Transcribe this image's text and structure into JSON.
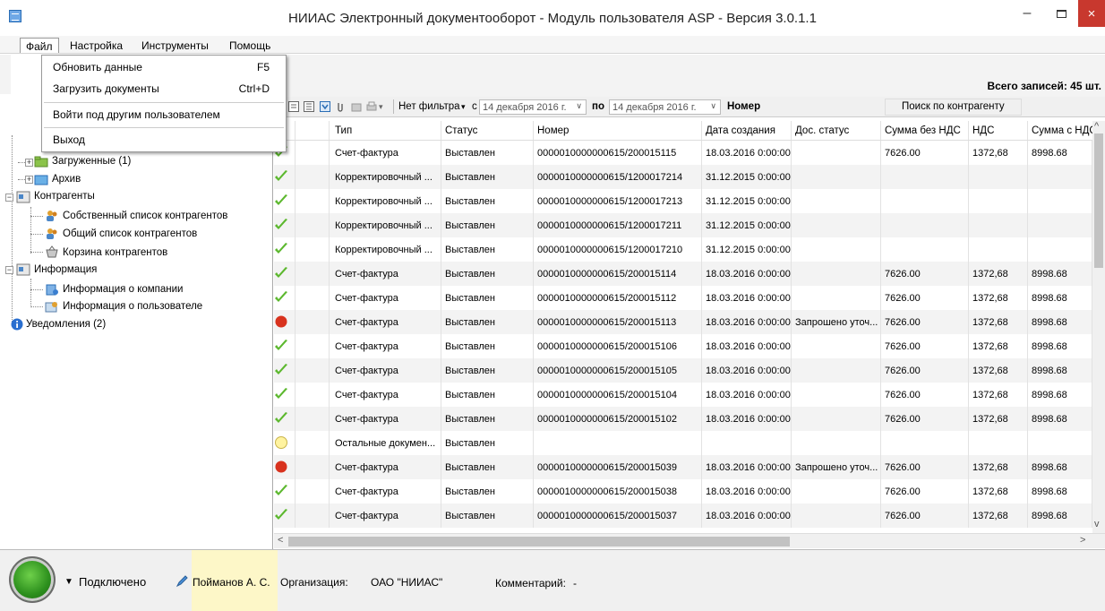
{
  "window": {
    "title": "НИИАС Электронный документооборот - Модуль пользователя ASP - Версия 3.0.1.1",
    "minimize": "–",
    "close": "×"
  },
  "menu": {
    "items": [
      "Файл",
      "Настройка",
      "Инструменты",
      "Помощь"
    ],
    "file_dropdown": {
      "refresh": "Обновить данные",
      "refresh_shortcut": "F5",
      "load": "Загрузить документы",
      "load_shortcut": "Ctrl+D",
      "switch_user": "Войти под другим пользователем",
      "exit": "Выход"
    }
  },
  "tree": {
    "loaded": "Загруженные (1)",
    "archive": "Архив",
    "counterparties": "Контрагенты",
    "own_list": "Собственный список контрагентов",
    "common_list": "Общий список контрагентов",
    "basket": "Корзина контрагентов",
    "info": "Информация",
    "company_info": "Информация о компании",
    "user_info": "Информация о пользователе",
    "notifications": "Уведомления (2)"
  },
  "summary": {
    "total": "Всего записей: 45 шт."
  },
  "filter": {
    "no_filter": "Нет фильтра",
    "from_label": "с",
    "from_date": "14 декабря  2016 г.",
    "to_label": "по",
    "to_date": "14 декабря  2016 г.",
    "number_label": "Номер",
    "search_counterparty": "Поиск по контрагенту"
  },
  "grid": {
    "columns": [
      "Тип",
      "Статус",
      "Номер",
      "Дата создания",
      "Дос. статус",
      "Сумма без НДС",
      "НДС",
      "Сумма с НДС"
    ],
    "rows": [
      {
        "status_icon": "check",
        "type": "Счет-фактура",
        "status": "Выставлен",
        "number": "0000010000000615/200015115",
        "date": "18.03.2016 0:00:00",
        "doc_status": "",
        "sum_no_vat": "7626.00",
        "vat": "1372,68",
        "sum_vat": "8998.68"
      },
      {
        "status_icon": "check",
        "type": "Корректировочный ...",
        "status": "Выставлен",
        "number": "0000010000000615/1200017214",
        "date": "31.12.2015 0:00:00",
        "doc_status": "",
        "sum_no_vat": "",
        "vat": "",
        "sum_vat": ""
      },
      {
        "status_icon": "check",
        "type": "Корректировочный ...",
        "status": "Выставлен",
        "number": "0000010000000615/1200017213",
        "date": "31.12.2015 0:00:00",
        "doc_status": "",
        "sum_no_vat": "",
        "vat": "",
        "sum_vat": ""
      },
      {
        "status_icon": "check",
        "type": "Корректировочный ...",
        "status": "Выставлен",
        "number": "0000010000000615/1200017211",
        "date": "31.12.2015 0:00:00",
        "doc_status": "",
        "sum_no_vat": "",
        "vat": "",
        "sum_vat": ""
      },
      {
        "status_icon": "check",
        "type": "Корректировочный ...",
        "status": "Выставлен",
        "number": "0000010000000615/1200017210",
        "date": "31.12.2015 0:00:00",
        "doc_status": "",
        "sum_no_vat": "",
        "vat": "",
        "sum_vat": ""
      },
      {
        "status_icon": "check",
        "type": "Счет-фактура",
        "status": "Выставлен",
        "number": "0000010000000615/200015114",
        "date": "18.03.2016 0:00:00",
        "doc_status": "",
        "sum_no_vat": "7626.00",
        "vat": "1372,68",
        "sum_vat": "8998.68"
      },
      {
        "status_icon": "check",
        "type": "Счет-фактура",
        "status": "Выставлен",
        "number": "0000010000000615/200015112",
        "date": "18.03.2016 0:00:00",
        "doc_status": "",
        "sum_no_vat": "7626.00",
        "vat": "1372,68",
        "sum_vat": "8998.68"
      },
      {
        "status_icon": "red",
        "type": "Счет-фактура",
        "status": "Выставлен",
        "number": "0000010000000615/200015113",
        "date": "18.03.2016 0:00:00",
        "doc_status": "Запрошено уточ...",
        "sum_no_vat": "7626.00",
        "vat": "1372,68",
        "sum_vat": "8998.68"
      },
      {
        "status_icon": "check",
        "type": "Счет-фактура",
        "status": "Выставлен",
        "number": "0000010000000615/200015106",
        "date": "18.03.2016 0:00:00",
        "doc_status": "",
        "sum_no_vat": "7626.00",
        "vat": "1372,68",
        "sum_vat": "8998.68"
      },
      {
        "status_icon": "check",
        "type": "Счет-фактура",
        "status": "Выставлен",
        "number": "0000010000000615/200015105",
        "date": "18.03.2016 0:00:00",
        "doc_status": "",
        "sum_no_vat": "7626.00",
        "vat": "1372,68",
        "sum_vat": "8998.68"
      },
      {
        "status_icon": "check",
        "type": "Счет-фактура",
        "status": "Выставлен",
        "number": "0000010000000615/200015104",
        "date": "18.03.2016 0:00:00",
        "doc_status": "",
        "sum_no_vat": "7626.00",
        "vat": "1372,68",
        "sum_vat": "8998.68"
      },
      {
        "status_icon": "check",
        "type": "Счет-фактура",
        "status": "Выставлен",
        "number": "0000010000000615/200015102",
        "date": "18.03.2016 0:00:00",
        "doc_status": "",
        "sum_no_vat": "7626.00",
        "vat": "1372,68",
        "sum_vat": "8998.68"
      },
      {
        "status_icon": "yellow",
        "type": "Остальные докумен...",
        "status": "Выставлен",
        "number": "",
        "date": "",
        "doc_status": "",
        "sum_no_vat": "",
        "vat": "",
        "sum_vat": ""
      },
      {
        "status_icon": "red",
        "type": "Счет-фактура",
        "status": "Выставлен",
        "number": "0000010000000615/200015039",
        "date": "18.03.2016 0:00:00",
        "doc_status": "Запрошено уточ...",
        "sum_no_vat": "7626.00",
        "vat": "1372,68",
        "sum_vat": "8998.68"
      },
      {
        "status_icon": "check",
        "type": "Счет-фактура",
        "status": "Выставлен",
        "number": "0000010000000615/200015038",
        "date": "18.03.2016 0:00:00",
        "doc_status": "",
        "sum_no_vat": "7626.00",
        "vat": "1372,68",
        "sum_vat": "8998.68"
      },
      {
        "status_icon": "check",
        "type": "Счет-фактура",
        "status": "Выставлен",
        "number": "0000010000000615/200015037",
        "date": "18.03.2016 0:00:00",
        "doc_status": "",
        "sum_no_vat": "7626.00",
        "vat": "1372,68",
        "sum_vat": "8998.68"
      }
    ]
  },
  "status": {
    "connected": "Подключено",
    "user": "Пойманов А. С.",
    "org_label": "Организация:",
    "org": "ОАО \"НИИАС\"",
    "comment_label": "Комментарий:",
    "comment": "-"
  },
  "colors": {
    "check": "#5cb82e",
    "red": "#d8321e",
    "yellow": "#fff3a0"
  }
}
